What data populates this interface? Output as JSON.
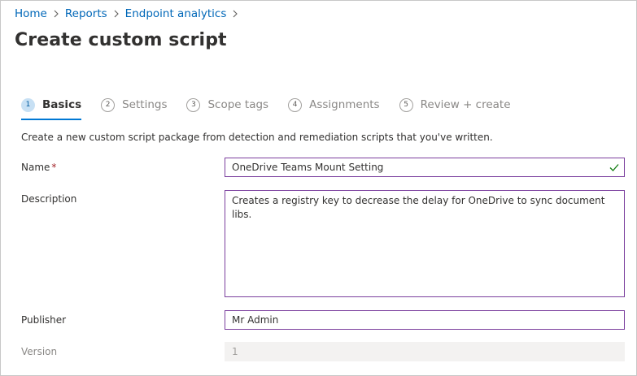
{
  "breadcrumb": [
    {
      "label": "Home"
    },
    {
      "label": "Reports"
    },
    {
      "label": "Endpoint analytics"
    }
  ],
  "title": "Create custom script",
  "steps": [
    {
      "num": "1",
      "label": "Basics",
      "active": true
    },
    {
      "num": "2",
      "label": "Settings"
    },
    {
      "num": "3",
      "label": "Scope tags"
    },
    {
      "num": "4",
      "label": "Assignments"
    },
    {
      "num": "5",
      "label": "Review + create"
    }
  ],
  "intro": "Create a new custom script package from detection and remediation scripts that you've written.",
  "fields": {
    "name": {
      "label": "Name",
      "required_mark": "*",
      "value": "OneDrive Teams Mount Setting"
    },
    "description": {
      "label": "Description",
      "value": "Creates a registry key to decrease the delay for OneDrive to sync document libs."
    },
    "publisher": {
      "label": "Publisher",
      "value": "Mr Admin"
    },
    "version": {
      "label": "Version",
      "value": "1"
    }
  },
  "colors": {
    "link": "#0067b8",
    "accent": "#0078d4",
    "input_border": "#7b3f9e",
    "valid_check": "#107c10",
    "required": "#a4262c"
  }
}
